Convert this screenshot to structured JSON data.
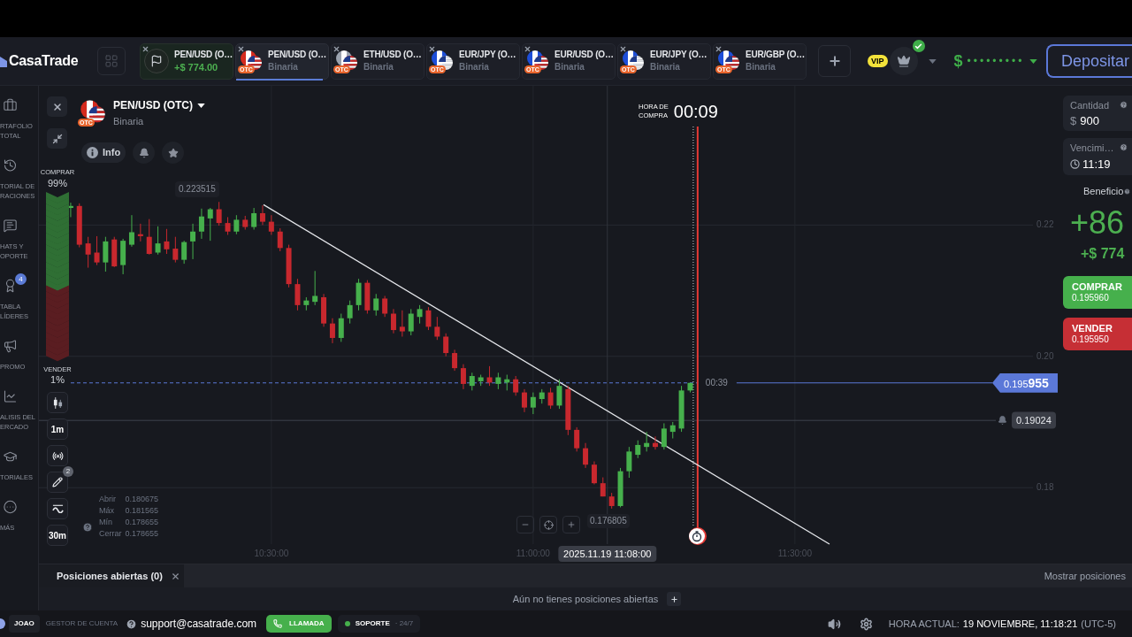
{
  "header": {
    "logo": "CasaTrade",
    "tabs": [
      {
        "kind": "trade",
        "title": "PEN/USD (O…",
        "profit": "+$ 774.00",
        "selected": false
      },
      {
        "kind": "asset",
        "title": "PEN/USD (O…",
        "subtitle": "Binaria",
        "badge": "OTC",
        "selected": true
      },
      {
        "kind": "asset",
        "title": "ETH/USD (O…",
        "subtitle": "Binaria",
        "badge": "OTC",
        "selected": false
      },
      {
        "kind": "asset",
        "title": "EUR/JPY (O…",
        "subtitle": "Binaria",
        "badge": "OTC",
        "selected": false
      },
      {
        "kind": "asset",
        "title": "EUR/USD (O…",
        "subtitle": "Binaria",
        "badge": "OTC",
        "selected": false
      },
      {
        "kind": "asset",
        "title": "EUR/JPY (O…",
        "subtitle": "Binaria",
        "badge": "OTC",
        "selected": false
      },
      {
        "kind": "asset",
        "title": "EUR/GBP (O…",
        "subtitle": "Binaria",
        "badge": "OTC",
        "selected": false
      }
    ],
    "account": {
      "badge": "VIP",
      "verified": true
    },
    "balance": {
      "currency": "$",
      "masked": "•••••••••"
    },
    "deposit_button": "Depositar"
  },
  "sidebar": {
    "items": [
      {
        "label": "RTAFOLIO\nTOTAL"
      },
      {
        "label": "TORIAL DE\nRACIONES"
      },
      {
        "label": "HATS Y\nOPORTE"
      },
      {
        "label": "TABLA\nLÍDERES",
        "badge": "4"
      },
      {
        "label": "PROMO"
      },
      {
        "label": "ALISIS DEL\nERCADO"
      },
      {
        "label": "TORIALES"
      },
      {
        "label": "MÁS"
      }
    ]
  },
  "chart": {
    "asset": {
      "title": "PEN/USD (OTC)",
      "subtitle": "Binaria",
      "badge": "OTC"
    },
    "info_button": "Info",
    "sentiment": {
      "buy_label": "COMPRAR",
      "buy_share": "99%",
      "sell_label": "VENDER",
      "sell_share": "1%",
      "level": 0.58
    },
    "purchase_timer": {
      "label": "HORA DE\nCOMPRA",
      "value": "00:09"
    },
    "candle_timer": "00:39",
    "price_tag": "0.195**955**",
    "max_label": "0.223515",
    "min_label": "0.176805",
    "tools": [
      {
        "kind": "icon"
      },
      {
        "kind": "text",
        "label": "1m"
      },
      {
        "kind": "icon"
      },
      {
        "kind": "icon",
        "badge": "2"
      },
      {
        "kind": "icon"
      },
      {
        "kind": "text",
        "label": "30m"
      }
    ],
    "ohlc_info": [
      {
        "label": "Abrir",
        "value": "0.180675"
      },
      {
        "label": "Máx",
        "value": "0.181565"
      },
      {
        "label": "Mín",
        "value": "0.178655"
      },
      {
        "label": "Cerrar",
        "value": "0.178655"
      }
    ],
    "chart_data": [
      {
        "type": "candlestick",
        "series": [
          {
            "type": "candlestick",
            "x": [
              10.1167,
              10.1333,
              10.15,
              10.1667,
              10.1833,
              10.2,
              10.2167,
              10.2333,
              10.25,
              10.2667,
              10.2833,
              10.3,
              10.3167,
              10.3333,
              10.35,
              10.3667,
              10.3833,
              10.4,
              10.4167,
              10.4333,
              10.45,
              10.4667,
              10.4833,
              10.5,
              10.5167,
              10.5333,
              10.55,
              10.5667,
              10.5833,
              10.6,
              10.6167,
              10.6333,
              10.65,
              10.6667,
              10.6833,
              10.7,
              10.7167,
              10.7333,
              10.75,
              10.7667,
              10.7833,
              10.8,
              10.8167,
              10.8333,
              10.85,
              10.8667,
              10.8833,
              10.9,
              10.9167,
              10.9333,
              10.95,
              10.9667,
              10.9833,
              11,
              11.0167,
              11.0333,
              11.05,
              11.0667,
              11.0833,
              11.1,
              11.1167,
              11.1333,
              11.15,
              11.1667,
              11.1833,
              11.2,
              11.2167,
              11.2333,
              11.25,
              11.2667,
              11.2833,
              11.3
            ],
            "ohlc": [
              [
                0.2226,
                0.2234,
                0.2212,
                0.2229
              ],
              [
                0.2229,
                0.2233,
                0.2166,
                0.217
              ],
              [
                0.2172,
                0.2182,
                0.2135,
                0.2155
              ],
              [
                0.2158,
                0.2183,
                0.2139,
                0.2143
              ],
              [
                0.2143,
                0.2182,
                0.2129,
                0.2175
              ],
              [
                0.2178,
                0.2182,
                0.2136,
                0.2137
              ],
              [
                0.2139,
                0.2179,
                0.2125,
                0.2176
              ],
              [
                0.217,
                0.2215,
                0.2167,
                0.2189
              ],
              [
                0.2186,
                0.2202,
                0.2175,
                0.2183
              ],
              [
                0.2182,
                0.2209,
                0.2155,
                0.2156
              ],
              [
                0.2158,
                0.2198,
                0.2155,
                0.2172
              ],
              [
                0.2175,
                0.2194,
                0.2156,
                0.2163
              ],
              [
                0.2164,
                0.2182,
                0.2143,
                0.2147
              ],
              [
                0.2147,
                0.2176,
                0.2141,
                0.2174
              ],
              [
                0.2175,
                0.2202,
                0.2148,
                0.219
              ],
              [
                0.219,
                0.2225,
                0.2179,
                0.2213
              ],
              [
                0.221,
                0.2226,
                0.2176,
                0.2224
              ],
              [
                0.2224,
                0.223515,
                0.2199,
                0.2203
              ],
              [
                0.2203,
                0.2212,
                0.2185,
                0.219
              ],
              [
                0.219,
                0.2215,
                0.2186,
                0.2208
              ],
              [
                0.2208,
                0.2214,
                0.2193,
                0.2197
              ],
              [
                0.2197,
                0.2226,
                0.2193,
                0.2218
              ],
              [
                0.2218,
                0.223,
                0.22,
                0.2205
              ],
              [
                0.2205,
                0.2215,
                0.2185,
                0.219
              ],
              [
                0.219,
                0.2195,
                0.216,
                0.2165
              ],
              [
                0.2165,
                0.217,
                0.2105,
                0.211
              ],
              [
                0.211,
                0.2118,
                0.207,
                0.2078
              ],
              [
                0.2078,
                0.209,
                0.207,
                0.2085
              ],
              [
                0.2083,
                0.213,
                0.2078,
                0.2092
              ],
              [
                0.209,
                0.2095,
                0.2045,
                0.205
              ],
              [
                0.205,
                0.2058,
                0.202,
                0.2028
              ],
              [
                0.2028,
                0.2065,
                0.2022,
                0.2058
              ],
              [
                0.2058,
                0.2085,
                0.205,
                0.2078
              ],
              [
                0.2078,
                0.2118,
                0.207,
                0.2112
              ],
              [
                0.2112,
                0.2116,
                0.2065,
                0.207
              ],
              [
                0.207,
                0.2095,
                0.2062,
                0.2088
              ],
              [
                0.2088,
                0.2092,
                0.206,
                0.2065
              ],
              [
                0.2065,
                0.2072,
                0.2035,
                0.204
              ],
              [
                0.2045,
                0.207,
                0.203,
                0.2038
              ],
              [
                0.2038,
                0.2072,
                0.2032,
                0.2065
              ],
              [
                0.206,
                0.2078,
                0.205,
                0.2072
              ],
              [
                0.207,
                0.2075,
                0.204,
                0.2045
              ],
              [
                0.2045,
                0.206,
                0.2025,
                0.203
              ],
              [
                0.203,
                0.2035,
                0.2,
                0.2005
              ],
              [
                0.2005,
                0.201,
                0.1978,
                0.1982
              ],
              [
                0.1982,
                0.1988,
                0.195,
                0.1958
              ],
              [
                0.1955,
                0.1975,
                0.1948,
                0.197
              ],
              [
                0.1962,
                0.1972,
                0.1955,
                0.1968
              ],
              [
                0.1968,
                0.1985,
                0.1955,
                0.196
              ],
              [
                0.1958,
                0.1975,
                0.195,
                0.1968
              ],
              [
                0.196,
                0.1972,
                0.1948,
                0.1965
              ],
              [
                0.1965,
                0.197,
                0.194,
                0.1945
              ],
              [
                0.1945,
                0.195,
                0.1915,
                0.1922
              ],
              [
                0.1922,
                0.1945,
                0.1912,
                0.1938
              ],
              [
                0.1935,
                0.195,
                0.1928,
                0.1945
              ],
              [
                0.1945,
                0.1952,
                0.192,
                0.1925
              ],
              [
                0.1925,
                0.1965,
                0.192,
                0.1955
              ],
              [
                0.195,
                0.1955,
                0.188,
                0.1888
              ],
              [
                0.1888,
                0.1892,
                0.1855,
                0.186
              ],
              [
                0.186,
                0.1868,
                0.183,
                0.1835
              ],
              [
                0.1835,
                0.184,
                0.1805,
                0.180675
              ],
              [
                0.180675,
                0.181565,
                0.178655,
                0.178655
              ],
              [
                0.178655,
                0.1792,
                0.176805,
                0.1772
              ],
              [
                0.1772,
                0.183,
                0.177,
                0.1825
              ],
              [
                0.1825,
                0.1862,
                0.1815,
                0.1855
              ],
              [
                0.185,
                0.1872,
                0.1845,
                0.1865
              ],
              [
                0.1862,
                0.1885,
                0.1855,
                0.1868
              ],
              [
                0.1868,
                0.1878,
                0.1858,
                0.1862
              ],
              [
                0.1862,
                0.1898,
                0.1858,
                0.189
              ],
              [
                0.1885,
                0.19,
                0.1875,
                0.1895
              ],
              [
                0.189,
                0.1955,
                0.1885,
                0.1948
              ],
              [
                0.1948,
                0.19596,
                0.1945,
                0.195955
              ]
            ]
          },
          {
            "type": "line",
            "x": [
              10.485,
              11.566
            ],
            "values": [
              0.2231,
              0.1714
            ],
            "color": "#e5e7eb"
          }
        ],
        "xlim": [
          10.056,
          11.958
        ],
        "ylim": [
          0.1714,
          0.2412
        ],
        "xticks": [
          {
            "value": 10.5,
            "label": "10:30:00"
          },
          {
            "value": 11,
            "label": "11:00:00"
          },
          {
            "value": 11.5,
            "label": "11:30:00"
          }
        ],
        "yticks": [
          {
            "value": 0.22,
            "label": "0.22"
          },
          {
            "value": 0.2,
            "label": "0.20"
          },
          {
            "value": 0.18,
            "label": "0.18"
          }
        ],
        "grid": true,
        "ref_lines": [
          {
            "axis": "y",
            "value": 0.195955,
            "color": "#5b78d8",
            "line_style": "dashed"
          },
          {
            "axis": "y",
            "value": 0.19024,
            "label": "0.19024",
            "color": "#3f434d"
          },
          {
            "axis": "x",
            "value": 11.3142,
            "color": "#e53935"
          },
          {
            "axis": "x",
            "value": 11.3058,
            "color": "#d1d5db",
            "line_style": "dotted"
          },
          {
            "axis": "x",
            "value": 11.1417,
            "label": "2025.11.19 11:08:00",
            "color": "#30333c"
          }
        ]
      }
    ]
  },
  "trade_panel": {
    "amount": {
      "label": "Cantidad",
      "currency": "$",
      "value": "900"
    },
    "expiry": {
      "label": "Vencimi…",
      "value": "11:19"
    },
    "profit": {
      "label": "Beneficio",
      "percent": "+86",
      "amount": "+$ 774"
    },
    "buttons": [
      {
        "kind": "buy",
        "label": "COMPRAR",
        "price": "0.195960"
      },
      {
        "kind": "sell",
        "label": "VENDER",
        "price": "0.195950"
      }
    ]
  },
  "positions": {
    "tab": "Posiciones abiertas (0)",
    "show_button": "Mostrar posiciones",
    "empty_text": "Aún no tienes posiciones abiertas"
  },
  "footer": {
    "user": "JOAO",
    "manager_label": "GESTOR DE CUENTA",
    "email": "support@casatrade.com",
    "call_button": "LLAMADA",
    "support": {
      "label": "SOPORTE",
      "hours": "· 24/7",
      "online": true
    },
    "clock": {
      "label": "HORA ACTUAL:",
      "value": "19 NOVIEMBRE, 11:18:21",
      "zone": "(UTC-5)"
    }
  }
}
